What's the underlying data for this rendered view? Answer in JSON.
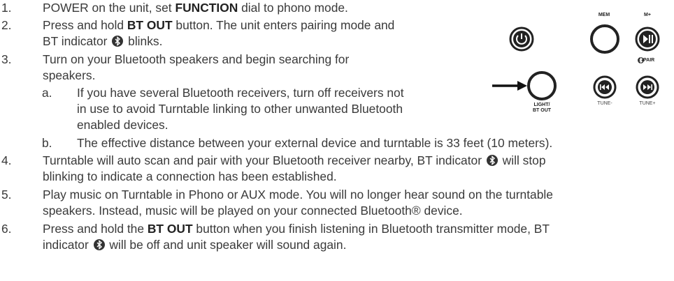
{
  "steps": [
    {
      "num": "1.",
      "parts": [
        "POWER on the unit, set ",
        "FUNCTION",
        " dial to phono mode."
      ]
    },
    {
      "num": "2.",
      "line1": [
        "Press and hold ",
        "BT OUT",
        " button. The unit enters pairing mode and"
      ],
      "line2": [
        "BT indicator ",
        " blinks."
      ]
    },
    {
      "num": "3.",
      "line1": "Turn on your Bluetooth speakers and begin searching for",
      "line2": "speakers."
    },
    {
      "num": "a.",
      "line1": "If you have several Bluetooth receivers, turn off receivers not",
      "line2": "in use to avoid Turntable linking to other unwanted Bluetooth",
      "line3": "enabled devices."
    },
    {
      "num": "b.",
      "line1": "The effective distance between your external device and turntable is 33 feet (10 meters)."
    },
    {
      "num": "4.",
      "line1": [
        "Turntable will auto scan and pair with your Bluetooth receiver nearby, BT indicator ",
        " will stop"
      ],
      "line2": "blinking to indicate a connection has been established."
    },
    {
      "num": "5.",
      "line1": "Play music on Turntable in Phono or AUX mode. You will no longer hear sound on the turntable",
      "line2": "speakers. Instead, music will be played on your connected Bluetooth® device."
    },
    {
      "num": "6.",
      "line1": [
        "Press and hold the ",
        "BT OUT",
        " button when you finish listening in Bluetooth transmitter mode, BT"
      ],
      "line2": [
        "indicator ",
        " will be off and unit speaker will sound again."
      ]
    }
  ],
  "panel": {
    "mem_label": "MEM",
    "mplus_label": "M+",
    "pair_label": "PAIR",
    "light_label_1": "LIGHT/",
    "light_label_2": "BT OUT",
    "tune_minus_label": "TUNE-",
    "tune_plus_label": "TUNE+"
  }
}
